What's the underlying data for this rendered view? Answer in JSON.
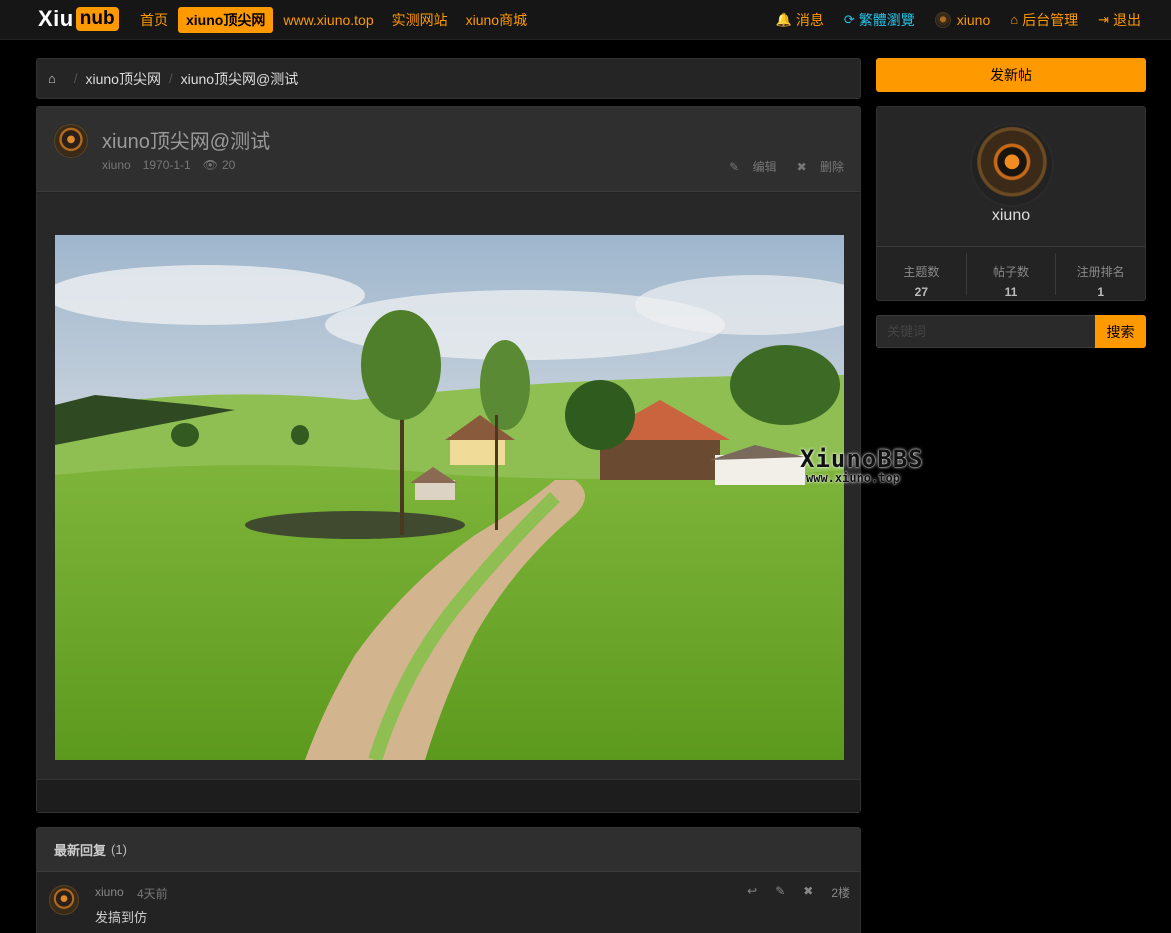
{
  "colors": {
    "accent": "#ff9900",
    "cyan": "#22c3e6",
    "background": "#000000"
  },
  "brand": {
    "logo_white": "Xiu",
    "logo_orange": "nub"
  },
  "nav": {
    "items": [
      "首页",
      "xiuno顶尖网",
      "www.xiuno.top",
      "实测网站",
      "xiuno商城"
    ],
    "active": "xiuno顶尖网"
  },
  "nav_right": {
    "messages": "消息",
    "traditional": "繁體瀏覽",
    "user": "xiuno",
    "admin": "后台管理",
    "logout": "退出"
  },
  "breadcrumb": {
    "home_icon": "home-icon",
    "items": [
      "xiuno顶尖网",
      "xiuno顶尖网@测试"
    ]
  },
  "thread": {
    "title": "xiuno顶尖网@测试",
    "author": "xiuno",
    "date": "1970-1-1",
    "views": "20",
    "edit_label": "编辑",
    "delete_label": "删除"
  },
  "replies": {
    "title": "最新回复",
    "count": "(1)",
    "items": [
      {
        "user": "xiuno",
        "time": "4天前",
        "text": "发搞到仿",
        "floor": "2楼"
      }
    ]
  },
  "sidebar": {
    "new_post": "发新帖",
    "profile_name": "xiuno",
    "stats": [
      {
        "label": "主题数",
        "value": "27"
      },
      {
        "label": "帖子数",
        "value": "11"
      },
      {
        "label": "注册排名",
        "value": "1"
      }
    ],
    "search_placeholder": "关键词",
    "search_button": "搜索"
  },
  "watermark": {
    "line1": "XiunoBBS",
    "line2": "www.xiuno.top"
  }
}
